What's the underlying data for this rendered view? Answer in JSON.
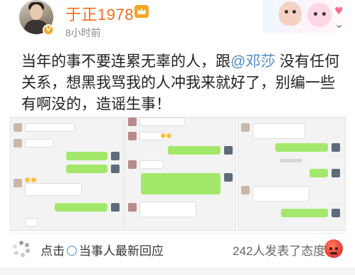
{
  "user": {
    "name": "于正1978",
    "post_time": "8小时前",
    "verified_badge": "V"
  },
  "post": {
    "text_before": "当年的事不要连累无辜的人，跟",
    "mention": "@邓莎",
    "text_after": " 没有任何关系，想黑我骂我的人冲我来就好了，别编一些有啊没的，造谣生事！"
  },
  "footer": {
    "reply_prefix": "点击",
    "reply_text": "当事人最新回应",
    "count_text": "242人发表了态度"
  },
  "colors": {
    "username": "#f26d1c",
    "mention": "#4a8bc9",
    "chat_green": "#a4e86b"
  },
  "icons": [
    "crown-icon",
    "verified-badge-icon",
    "chevron-down-icon",
    "loading-dots-icon",
    "reply-link-icon",
    "angry-emoji-icon"
  ]
}
